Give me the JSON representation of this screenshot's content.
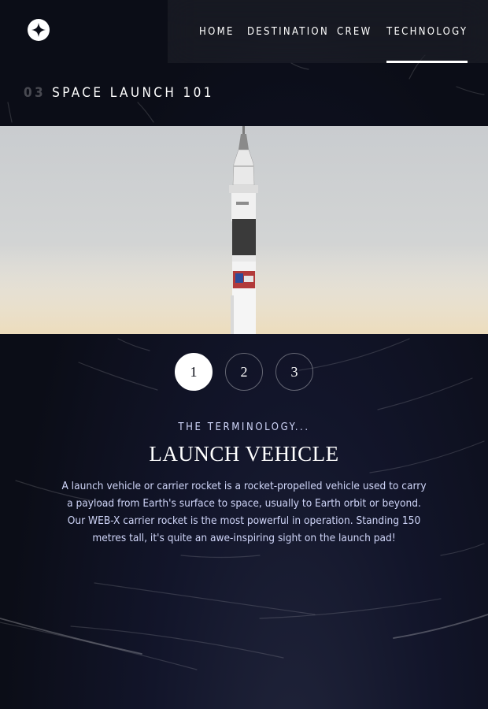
{
  "nav": {
    "items": [
      {
        "label": "HOME"
      },
      {
        "label": "DESTINATION"
      },
      {
        "label": "CREW"
      },
      {
        "label": "TECHNOLOGY"
      }
    ],
    "active": "TECHNOLOGY"
  },
  "page_heading": {
    "number": "03",
    "title": "SPACE LAUNCH 101"
  },
  "hero": {
    "image": "rocket-launch-vehicle"
  },
  "pager": {
    "items": [
      {
        "label": "1"
      },
      {
        "label": "2"
      },
      {
        "label": "3"
      }
    ],
    "active": "1"
  },
  "content": {
    "eyebrow": "THE TERMINOLOGY...",
    "title": "LAUNCH VEHICLE",
    "description": "A launch vehicle or carrier rocket is a rocket-propelled vehicle used to carry a payload from Earth's surface to space, usually to Earth orbit or beyond. Our WEB-X carrier rocket is the most powerful in operation. Standing 150 metres tall, it's quite an awe-inspiring sight on the launch pad!"
  },
  "colors": {
    "background": "#0b0d17",
    "accent": "#ffffff",
    "muted": "#d0d6f9"
  }
}
